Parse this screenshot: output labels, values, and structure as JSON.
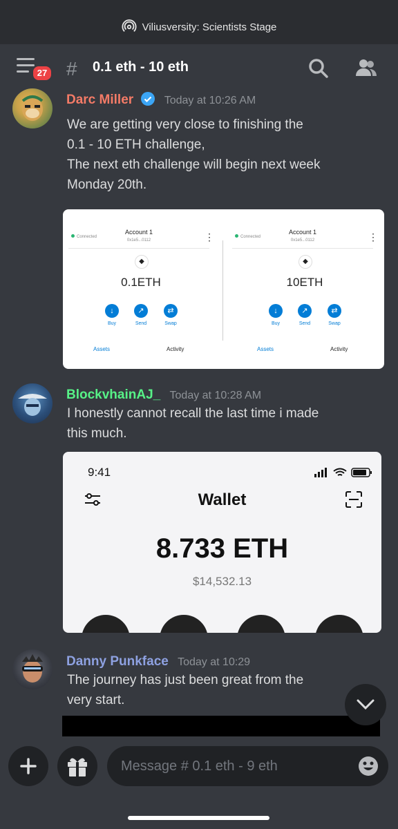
{
  "stage_banner": "Viliusversity: Scientists Stage",
  "header": {
    "unread_badge": "27",
    "hash": "#",
    "channel_name": "0.1 eth - 10 eth"
  },
  "messages": [
    {
      "author": "Darc Miller",
      "author_color": "#f47b67",
      "timestamp": "Today at 10:26 AM",
      "text": "We are getting very close to finishing the\n0.1 - 10 ETH challenge,\nThe next eth challenge will begin next week\nMonday 20th."
    },
    {
      "author": "BlockvhainAJ_",
      "author_color": "#57f287",
      "timestamp": "Today at 10:28 AM",
      "text": "I honestly cannot recall the last time i made\nthis much."
    },
    {
      "author": "Danny Punkface",
      "author_color": "#8ea1e1",
      "timestamp": "Today at 10:29",
      "text": "The journey has just been great from the\nvery start."
    }
  ],
  "embed1": {
    "wallets": [
      {
        "status": "Connected",
        "account": "Account 1",
        "address": "0x1e5...0112",
        "balance": "0.1ETH",
        "buttons": [
          "Buy",
          "Send",
          "Swap"
        ],
        "tabs": [
          "Assets",
          "Activity"
        ]
      },
      {
        "status": "Connected",
        "account": "Account 1",
        "address": "0x1e5...0112",
        "balance": "10ETH",
        "buttons": [
          "Buy",
          "Send",
          "Swap"
        ],
        "tabs": [
          "Assets",
          "Activity"
        ]
      }
    ]
  },
  "embed2": {
    "time": "9:41",
    "title": "Wallet",
    "balance": "8.733 ETH",
    "usd": "$14,532.13"
  },
  "composer": {
    "placeholder": "Message # 0.1 eth - 9 eth"
  },
  "colors": {
    "background": "#36393f",
    "topbar": "#2b2d31",
    "accent": "#ed4245",
    "link_blue": "#037dd6"
  }
}
